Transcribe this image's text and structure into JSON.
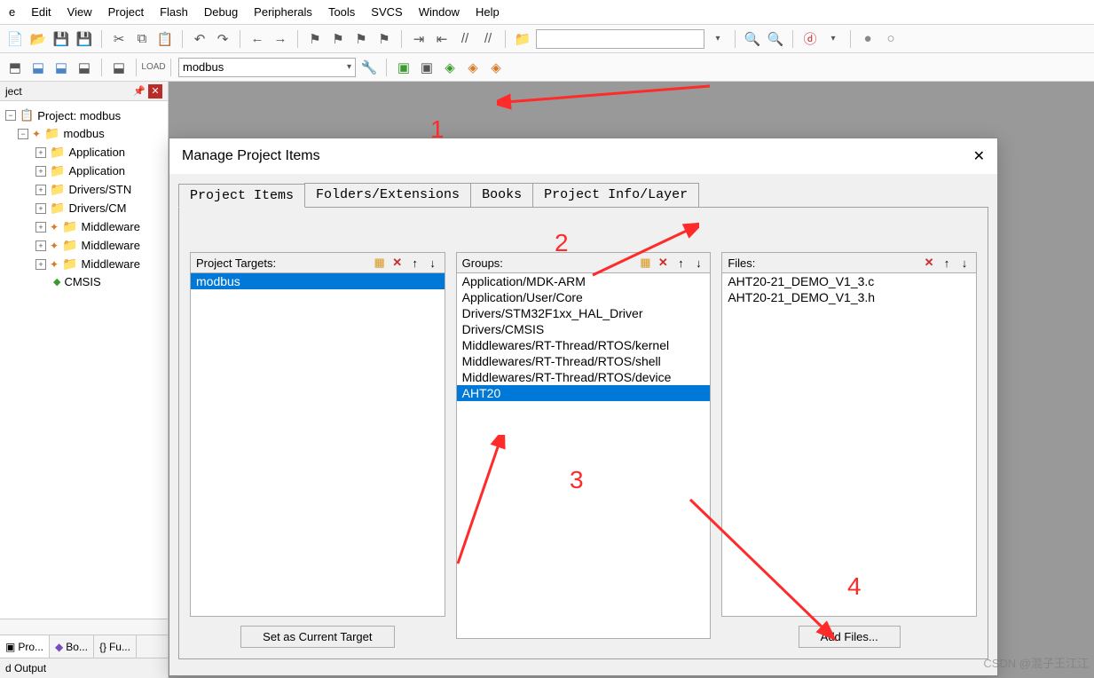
{
  "menu": {
    "items": [
      "e",
      "Edit",
      "View",
      "Project",
      "Flash",
      "Debug",
      "Peripherals",
      "Tools",
      "SVCS",
      "Window",
      "Help"
    ]
  },
  "toolbar2": {
    "target": "modbus"
  },
  "sidebar": {
    "panel_title": "ject",
    "tree": {
      "root": "Project: modbus",
      "target": "modbus",
      "groups": [
        "Application",
        "Application",
        "Drivers/STN",
        "Drivers/CM",
        "Middleware",
        "Middleware",
        "Middleware"
      ],
      "cmsis": "CMSIS"
    },
    "tabs": {
      "project": "Pro...",
      "books": "Bo...",
      "functions": "Fu..."
    }
  },
  "output_title": "d Output",
  "dialog": {
    "title": "Manage Project Items",
    "tabs": [
      "Project Items",
      "Folders/Extensions",
      "Books",
      "Project Info/Layer"
    ],
    "active_tab": 0,
    "targets_label": "Project Targets:",
    "groups_label": "Groups:",
    "files_label": "Files:",
    "targets": [
      "modbus"
    ],
    "groups": [
      "Application/MDK-ARM",
      "Application/User/Core",
      "Drivers/STM32F1xx_HAL_Driver",
      "Drivers/CMSIS",
      "Middlewares/RT-Thread/RTOS/kernel",
      "Middlewares/RT-Thread/RTOS/shell",
      "Middlewares/RT-Thread/RTOS/device",
      "AHT20"
    ],
    "groups_selected": 7,
    "files": [
      "AHT20-21_DEMO_V1_3.c",
      "AHT20-21_DEMO_V1_3.h"
    ],
    "set_target_btn": "Set as Current Target",
    "add_files_btn": "Add Files..."
  },
  "annotations": {
    "a1": "1",
    "a2": "2",
    "a3": "3",
    "a4": "4"
  },
  "watermark": "CSDN @混子王江江"
}
